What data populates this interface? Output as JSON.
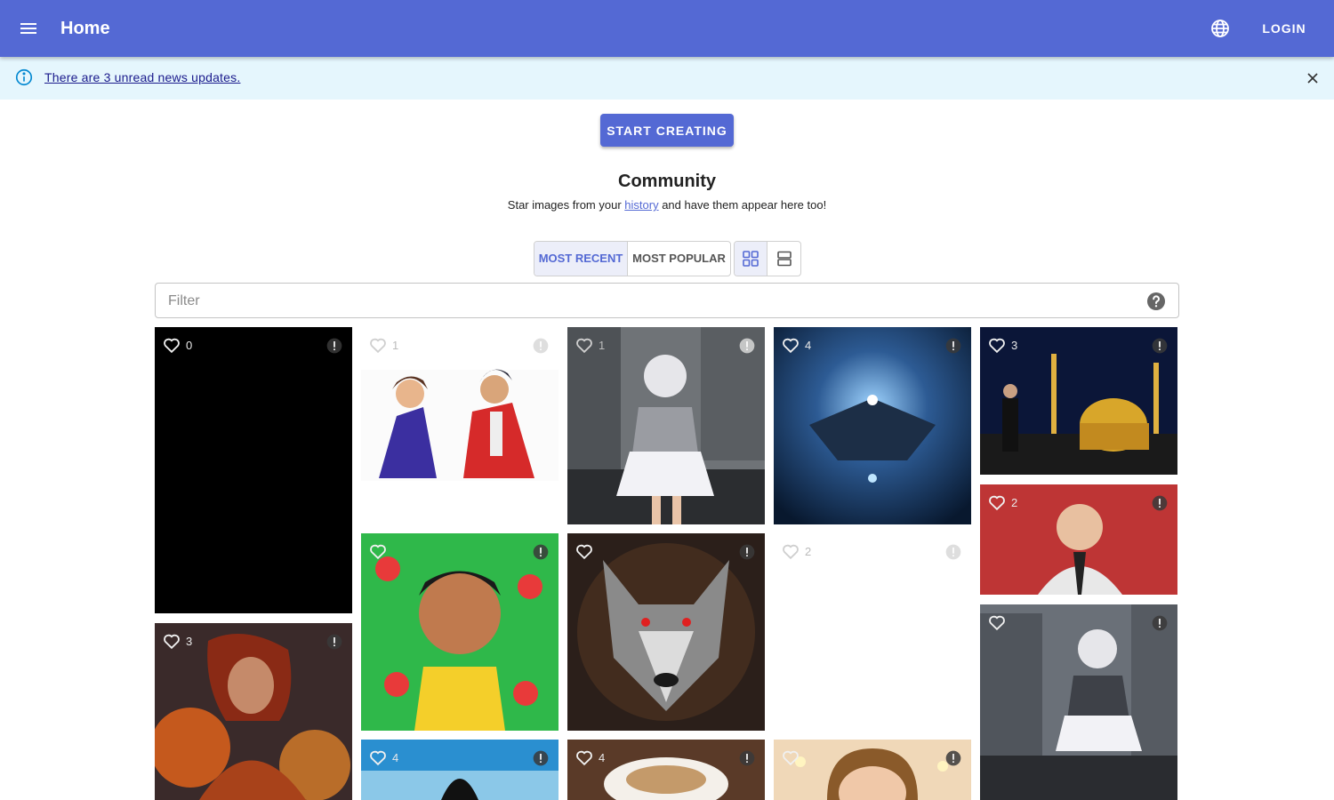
{
  "appbar": {
    "title": "Home",
    "menu_icon": "menu-icon",
    "language_icon": "globe-icon",
    "login_label": "LOGIN",
    "color": "#5469d4"
  },
  "alert": {
    "message": "There are 3 unread news updates.",
    "info_icon": "info-icon",
    "close_icon": "close-icon",
    "background": "#e5f6fd"
  },
  "cta": {
    "label": "START CREATING"
  },
  "community": {
    "title": "Community",
    "subtitle_before": "Star images from your ",
    "subtitle_link": "history",
    "subtitle_after": " and have them appear here too!"
  },
  "sort": {
    "options": [
      "MOST RECENT",
      "MOST POPULAR"
    ],
    "selected": "MOST RECENT"
  },
  "view": {
    "options": [
      "grid-view-icon",
      "list-view-icon"
    ],
    "selected": "grid-view-icon"
  },
  "filter": {
    "placeholder": "Filter",
    "value": "",
    "help_icon": "help-icon"
  },
  "gallery": [
    {
      "likes": "0",
      "scene": "black image"
    },
    {
      "likes": "1",
      "scene": "two cartoon men in suits"
    },
    {
      "likes": "1",
      "scene": "anime girl in ruined city"
    },
    {
      "likes": "4",
      "scene": "spaceship in orbit"
    },
    {
      "likes": "3",
      "scene": "man in front of golden dome at night"
    },
    {
      "likes": "2",
      "scene": "man at Oppenheimer premiere"
    },
    {
      "likes": "3",
      "scene": "fire sorceress"
    },
    {
      "likes": "",
      "scene": "cartoon boy with flowers"
    },
    {
      "likes": "",
      "scene": "wolf portrait"
    },
    {
      "likes": "2",
      "scene": "blank image"
    },
    {
      "likes": "",
      "scene": "anime girl among ruins"
    },
    {
      "likes": "4",
      "scene": "cat at the beach"
    },
    {
      "likes": "4",
      "scene": "latte art cup"
    },
    {
      "likes": "",
      "scene": "cartoon girl with lights"
    }
  ]
}
